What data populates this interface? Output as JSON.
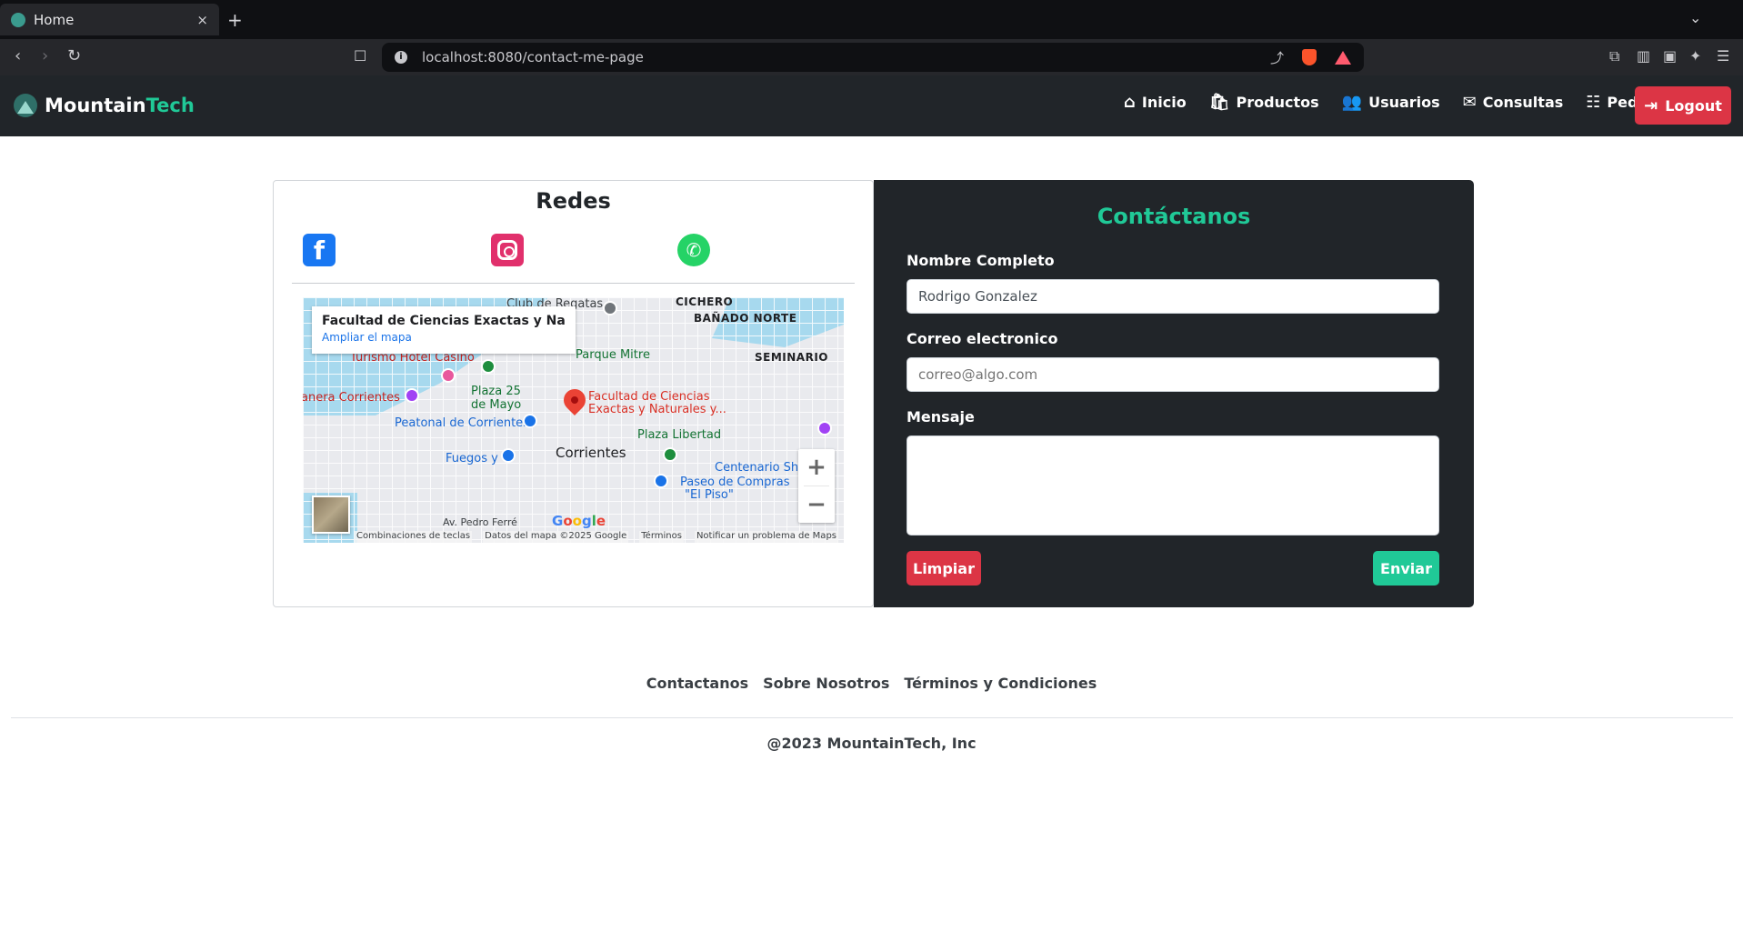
{
  "browser": {
    "tab_title": "Home",
    "tab_close": "×",
    "new_tab": "+",
    "url": "localhost:8080/contact-me-page",
    "back": "‹",
    "forward": "›",
    "reload": "↻",
    "bookmark": "☐",
    "share": "⤴",
    "menu": "☰",
    "tab_chevron": "⌄"
  },
  "navbar": {
    "brand_main": "Mountain",
    "brand_accent": "Tech",
    "links": [
      {
        "icon": "⌂",
        "label": "Inicio"
      },
      {
        "icon": "🛍",
        "label": "Productos"
      },
      {
        "icon": "👥",
        "label": "Usuarios"
      },
      {
        "icon": "✉",
        "label": "Consultas"
      },
      {
        "icon": "☷",
        "label": "Pedidos"
      }
    ],
    "logout_icon": "⇥",
    "logout_label": "Logout"
  },
  "social": {
    "title": "Redes",
    "facebook_glyph": "f",
    "whatsapp_glyph": "✆"
  },
  "map": {
    "info_title": "Facultad de Ciencias Exactas y Natu...",
    "info_link": "Ampliar el mapa",
    "labels": {
      "club": "Club de Regatas",
      "cichero": "CICHERO",
      "banado": "BAÑADO NORTE",
      "parque": "Parque Mitre",
      "seminario": "SEMINARIO",
      "turismo": "Turismo Hotel Casino",
      "costanera": "anera Corrientes",
      "plaza25a": "Plaza 25",
      "plaza25b": "de Mayo",
      "facultad_a": "Facultad de Ciencias",
      "facultad_b": "Exactas y Naturales y...",
      "peatonal": "Peatonal de Corrientes",
      "plaza_libertad": "Plaza Libertad",
      "fuegos": "Fuegos y",
      "corrientes": "Corrientes",
      "centenario": "Centenario Sho",
      "paseo_a": "Paseo de Compras",
      "paseo_b": "\"El Piso\"",
      "pedro": "Av. Pedro Ferré"
    },
    "zoom_in": "+",
    "zoom_out": "−",
    "google": "Google",
    "attribution": [
      "Combinaciones de teclas",
      "Datos del mapa ©2025 Google",
      "Términos",
      "Notificar un problema de Maps"
    ]
  },
  "form": {
    "title": "Contáctanos",
    "name_label": "Nombre Completo",
    "name_value": "Rodrigo Gonzalez",
    "email_label": "Correo electronico",
    "email_placeholder": "correo@algo.com",
    "message_label": "Mensaje",
    "clear_label": "Limpiar",
    "send_label": "Enviar"
  },
  "footer": {
    "links": [
      "Contactanos",
      "Sobre Nosotros",
      "Términos y Condiciones"
    ],
    "copyright": "@2023 MountainTech, Inc"
  },
  "colors": {
    "accent": "#20c997",
    "danger": "#dc3545",
    "dark": "#212529"
  }
}
